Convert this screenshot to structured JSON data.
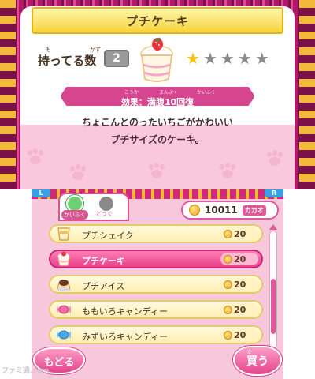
{
  "item": {
    "title": "プチケーキ",
    "qty_label": "持ってる数",
    "qty_ruby": [
      "も",
      "かず"
    ],
    "qty_value": "2",
    "stars_filled": 1,
    "stars_total": 5,
    "effect": "効果：満腹10回復",
    "effect_ruby": [
      "こうか",
      "まんぷく",
      "かいふく"
    ],
    "description_line1": "ちょこんとのったいちごがかわいい",
    "description_line2": "プチサイズのケーキ。"
  },
  "controls": {
    "l_button": "L",
    "r_button": "R"
  },
  "tabs": {
    "kaifuku": "かいふく",
    "dougu": "どうぐ"
  },
  "currency": {
    "value": "10011",
    "unit": "カカオ"
  },
  "items": [
    {
      "name": "プチシェイク",
      "price": "20",
      "icon": "shake-icon",
      "selected": false
    },
    {
      "name": "プチケーキ",
      "price": "20",
      "icon": "cake-icon",
      "selected": true
    },
    {
      "name": "プチアイス",
      "price": "20",
      "icon": "pudding-icon",
      "selected": false
    },
    {
      "name": "ももいろキャンディー",
      "price": "20",
      "icon": "pink-candy-icon",
      "selected": false
    },
    {
      "name": "みずいろキャンディー",
      "price": "20",
      "icon": "blue-candy-icon",
      "selected": false
    }
  ],
  "buttons": {
    "back": "もどる",
    "buy": "買う",
    "buy_ruby": "か"
  },
  "watermark": "ファミ通.com",
  "colors": {
    "accent_pink": "#e05a9b",
    "title_yellow": "#f4d43c",
    "star_gold": "#f2c21a",
    "star_gray": "#8a8a8a"
  }
}
